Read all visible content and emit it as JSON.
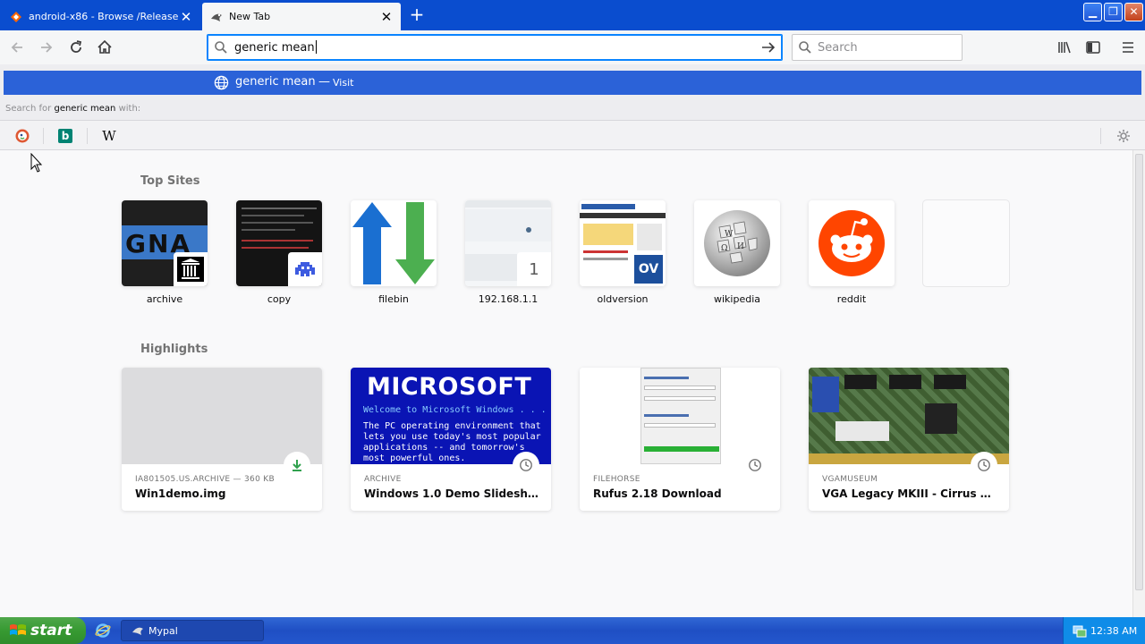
{
  "tabs": [
    {
      "title": "android-x86 - Browse /Release 2...",
      "close": "✕",
      "active": false
    },
    {
      "title": "New Tab",
      "close": "✕",
      "active": true
    }
  ],
  "window_controls": {
    "minimize": "▁",
    "maximize": "❐",
    "close": "✕"
  },
  "newtab_button": "+",
  "urlbar": {
    "value": "generic mean"
  },
  "searchbar": {
    "placeholder": "Search"
  },
  "autocomplete": {
    "result_title": "generic mean",
    "separator": "—",
    "result_action": "Visit",
    "search_for_prefix": "Search for ",
    "search_for_query": "generic mean",
    "search_for_suffix": " with:",
    "engines": [
      {
        "name": "DuckDuckGo",
        "icon": "duckduckgo-icon"
      },
      {
        "name": "Bing",
        "icon": "bing-icon",
        "glyph": "b"
      },
      {
        "name": "Wikipedia",
        "icon": "wikipedia-icon",
        "glyph": "W"
      }
    ]
  },
  "newtab": {
    "topsites_title": "Top Sites",
    "topsites": [
      {
        "label": "archive",
        "badge_icon": "archive-icon"
      },
      {
        "label": "copy",
        "badge_icon": "invader-icon"
      },
      {
        "label": "filebin",
        "badge_icon": "updown-arrows-icon"
      },
      {
        "label": "192.168.1.1",
        "badge_text": "1"
      },
      {
        "label": "oldversion",
        "badge_text": "OV"
      },
      {
        "label": "wikipedia",
        "badge_icon": "wikipedia-globe-icon"
      },
      {
        "label": "reddit",
        "badge_icon": "reddit-icon"
      },
      {
        "label": "",
        "badge_icon": ""
      }
    ],
    "highlights_title": "Highlights",
    "highlights": [
      {
        "source": "IA801505.US.ARCHIVE — 360 KB",
        "title": "Win1demo.img",
        "type_icon": "download-icon"
      },
      {
        "source": "ARCHIVE",
        "title": "Windows 1.0 Demo Slideshow (...",
        "type_icon": "history-clock-icon",
        "thumb_heading": "MICROSOFT",
        "thumb_sub": "Welcome to Microsoft Windows . . .",
        "thumb_body": "The PC operating environment that lets you use today's most popular applications -- and tomorrow's most powerful ones."
      },
      {
        "source": "FILEHORSE",
        "title": "Rufus 2.18 Download",
        "type_icon": "history-clock-icon"
      },
      {
        "source": "VGAMUSEUM",
        "title": "VGA Legacy MKIII - Cirrus Logic ...",
        "type_icon": "history-clock-icon"
      }
    ]
  },
  "taskbar": {
    "start_label": "start",
    "task_label": "Mypal",
    "clock": "12:38 AM"
  },
  "colors": {
    "accent": "#0a84ff",
    "autocomplete_selected": "#2b62d8",
    "titlebar": "#0a4dcf",
    "reddit": "#ff4500",
    "filebin_blue": "#1a6fd1",
    "filebin_green": "#4caf50",
    "xp_start_green": "#379a32"
  }
}
